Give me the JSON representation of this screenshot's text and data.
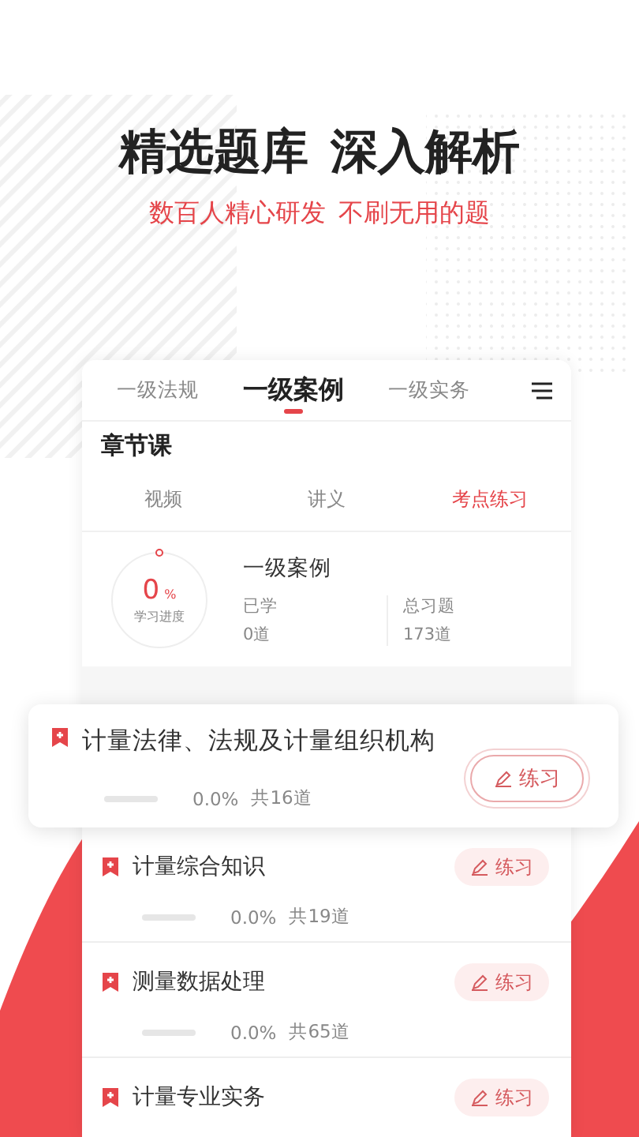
{
  "headline": [
    "精选题库",
    "深入解析"
  ],
  "subtitle": [
    "数百人精心研发",
    "不刷无用的题"
  ],
  "exam_tabs": [
    {
      "label": "一级法规",
      "selected": false
    },
    {
      "label": "一级案例",
      "selected": true
    },
    {
      "label": "一级实务",
      "selected": false
    }
  ],
  "section_title": "章节课",
  "sub_tabs": [
    {
      "label": "视频",
      "selected": false
    },
    {
      "label": "讲义",
      "selected": false
    },
    {
      "label": "考点练习",
      "selected": true
    }
  ],
  "progress": {
    "value": "0",
    "unit": "%",
    "caption": "学习进度"
  },
  "course_name": "一级案例",
  "stats": [
    {
      "label": "已学",
      "value": "0道"
    },
    {
      "label": "总习题",
      "value": "173道"
    }
  ],
  "lessons": [
    {
      "kind": "featured",
      "title": "计量法律、法规及计量组织机构",
      "level": 0,
      "percent": "0.0%",
      "count": "共16道",
      "button": "练习"
    },
    {
      "kind": "normal",
      "title": "计量综合知识",
      "level": 0,
      "percent": "0.0%",
      "count": "共19道",
      "button": "练习"
    },
    {
      "kind": "normal",
      "title": "测量数据处理",
      "level": 0,
      "percent": "0.0%",
      "count": "共65道",
      "button": "练习"
    },
    {
      "kind": "normal",
      "title": "计量专业实务",
      "button": "练习"
    }
  ]
}
